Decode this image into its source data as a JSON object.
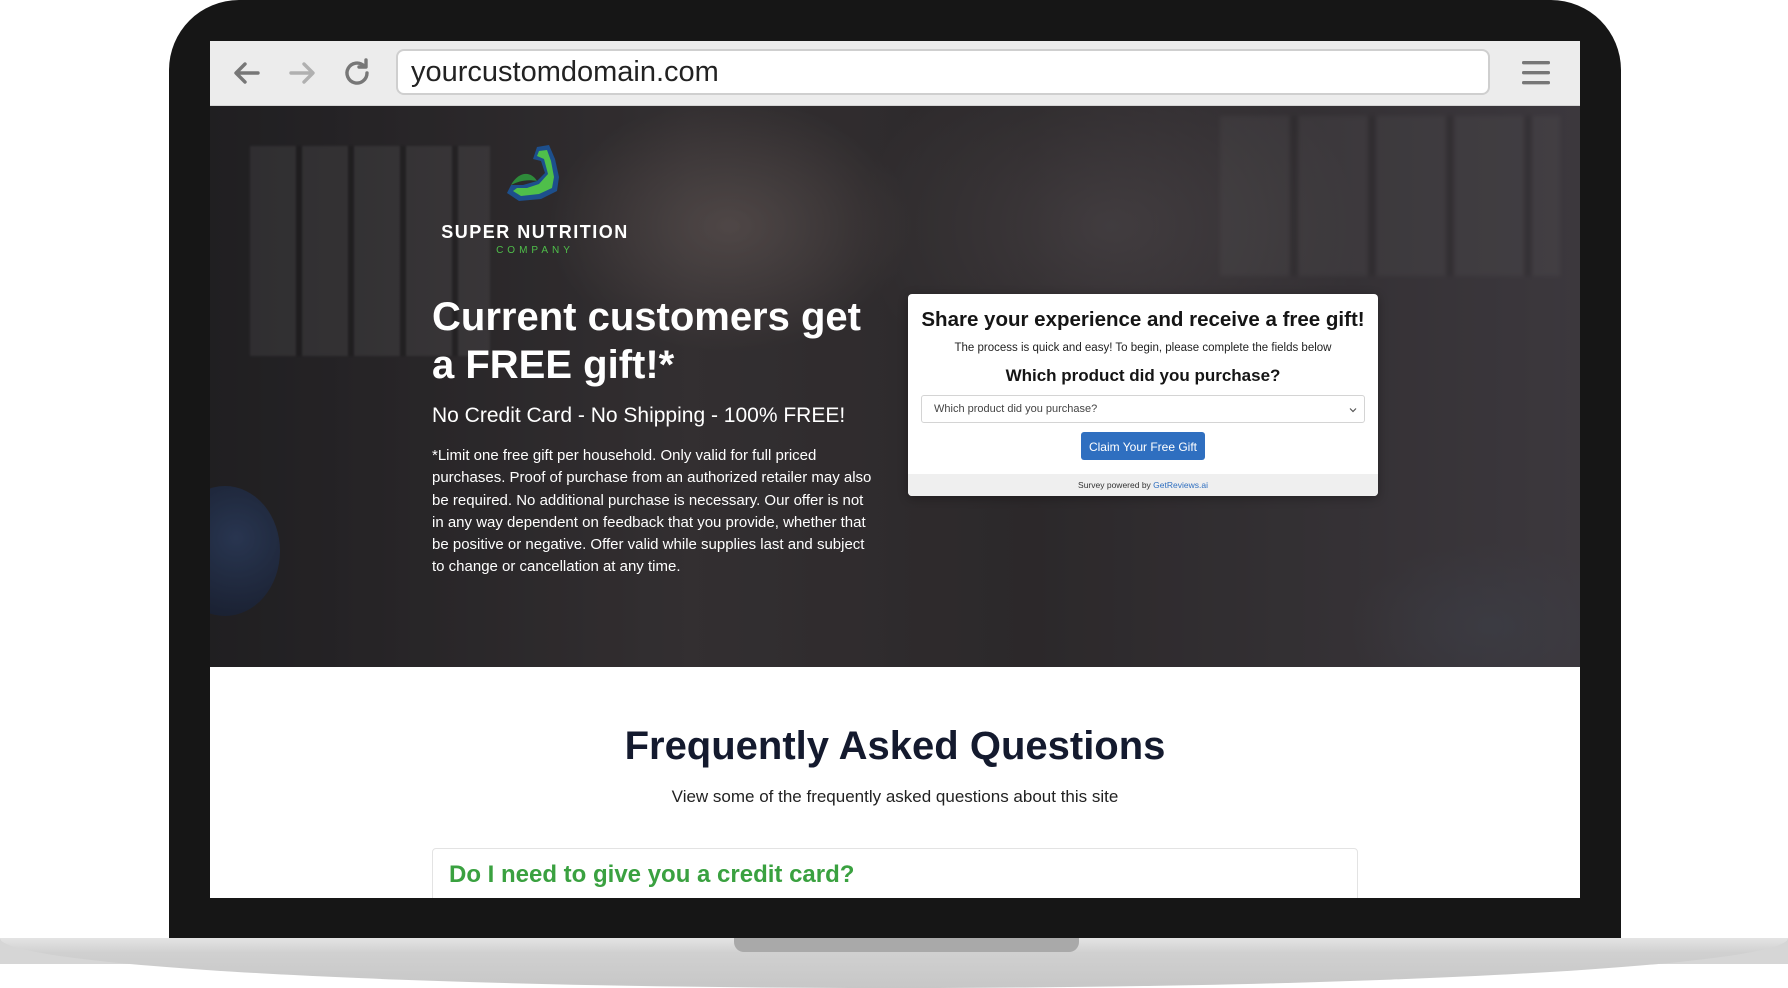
{
  "browser": {
    "url": "yourcustomdomain.com",
    "back_icon": "arrow-left-icon",
    "forward_icon": "arrow-right-icon",
    "reload_icon": "reload-icon",
    "menu_icon": "hamburger-menu-icon"
  },
  "logo": {
    "name": "SUPER NUTRITION",
    "subtitle": "COMPANY",
    "icon": "flexed-arm-leaf-icon",
    "colors": {
      "green": "#4fbf4a",
      "blue": "#1d4f8c"
    }
  },
  "hero": {
    "headline": "Current customers get a FREE gift!*",
    "subheadline": "No Credit Card - No Shipping - 100% FREE!",
    "disclaimer": "*Limit one free gift per household. Only valid for full priced purchases. Proof of purchase from an authorized retailer may also be required. No additional purchase is necessary. Our offer is not in any way dependent on feedback that you provide, whether that be positive or negative. Offer valid while supplies last and subject to change or cancellation at any time."
  },
  "survey": {
    "title": "Share your experience and receive a free gift!",
    "description": "The process is quick and easy! To begin, please complete the fields below",
    "question": "Which product did you purchase?",
    "select_placeholder": "Which product did you purchase?",
    "button_label": "Claim Your Free Gift",
    "footer_prefix": "Survey powered by",
    "footer_link": "GetReviews.ai",
    "accent_color": "#2f6fc0"
  },
  "faq": {
    "title": "Frequently Asked Questions",
    "subtitle": "View some of the frequently asked questions about this site",
    "items": [
      {
        "question": "Do I need to give you a credit card?"
      }
    ],
    "accent_color": "#3aa140"
  }
}
